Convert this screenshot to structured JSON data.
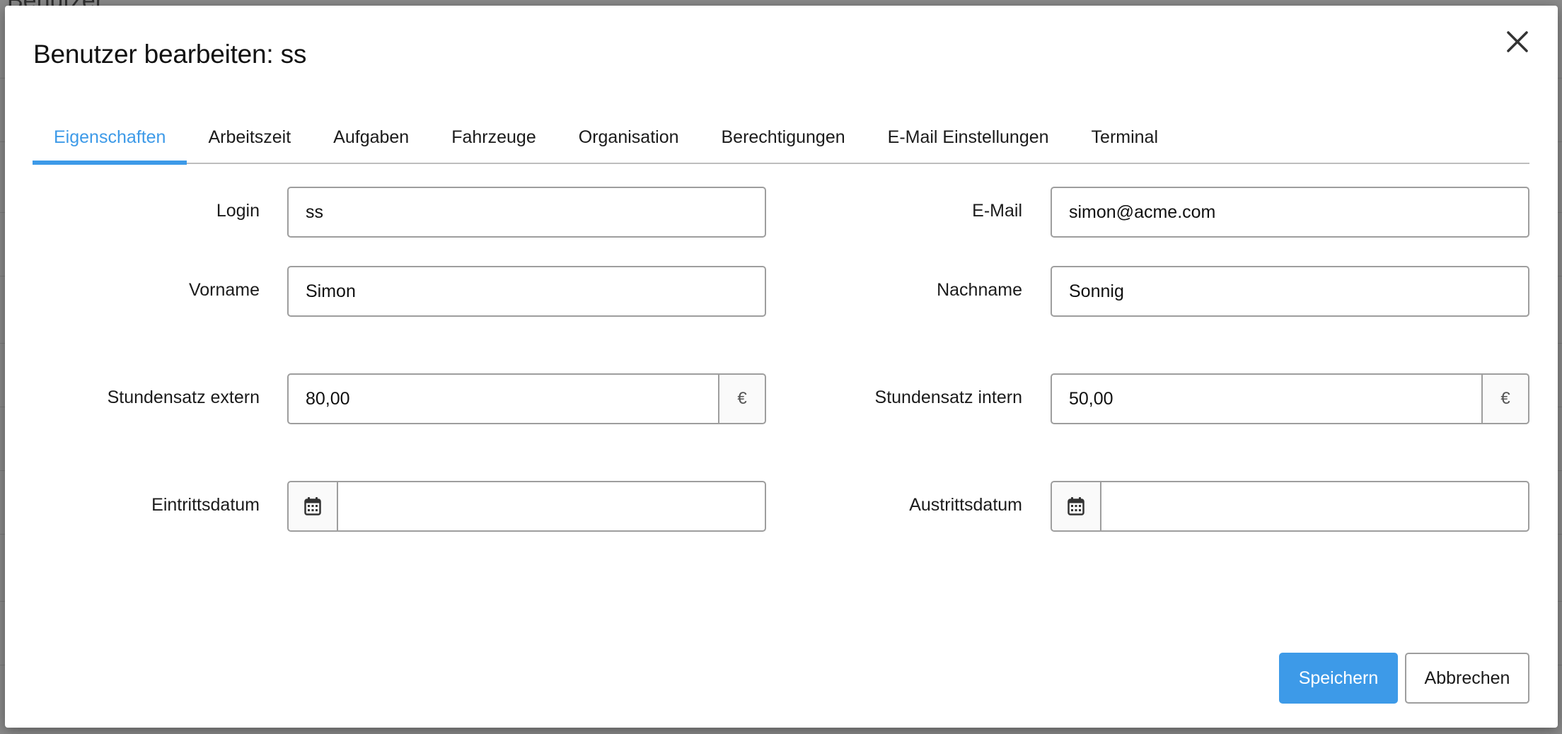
{
  "background": {
    "title": "Benutzer"
  },
  "modal": {
    "title": "Benutzer bearbeiten: ss"
  },
  "tabs": [
    {
      "label": "Eigenschaften",
      "active": true
    },
    {
      "label": "Arbeitszeit",
      "active": false
    },
    {
      "label": "Aufgaben",
      "active": false
    },
    {
      "label": "Fahrzeuge",
      "active": false
    },
    {
      "label": "Organisation",
      "active": false
    },
    {
      "label": "Berechtigungen",
      "active": false
    },
    {
      "label": "E-Mail Einstellungen",
      "active": false
    },
    {
      "label": "Terminal",
      "active": false
    }
  ],
  "form": {
    "login": {
      "label": "Login",
      "value": "ss"
    },
    "email": {
      "label": "E-Mail",
      "value": "simon@acme.com"
    },
    "vorname": {
      "label": "Vorname",
      "value": "Simon"
    },
    "nachname": {
      "label": "Nachname",
      "value": "Sonnig"
    },
    "rate_extern": {
      "label": "Stundensatz extern",
      "value": "80,00",
      "unit": "€"
    },
    "rate_intern": {
      "label": "Stundensatz intern",
      "value": "50,00",
      "unit": "€"
    },
    "eintritt": {
      "label": "Eintrittsdatum",
      "value": ""
    },
    "austritt": {
      "label": "Austrittsdatum",
      "value": ""
    }
  },
  "buttons": {
    "save": "Speichern",
    "cancel": "Abbrechen"
  },
  "colors": {
    "accent": "#3d9ae8",
    "overlay": "#8a8a8a"
  },
  "icons": {
    "close": "close-icon",
    "calendar": "calendar-icon"
  }
}
